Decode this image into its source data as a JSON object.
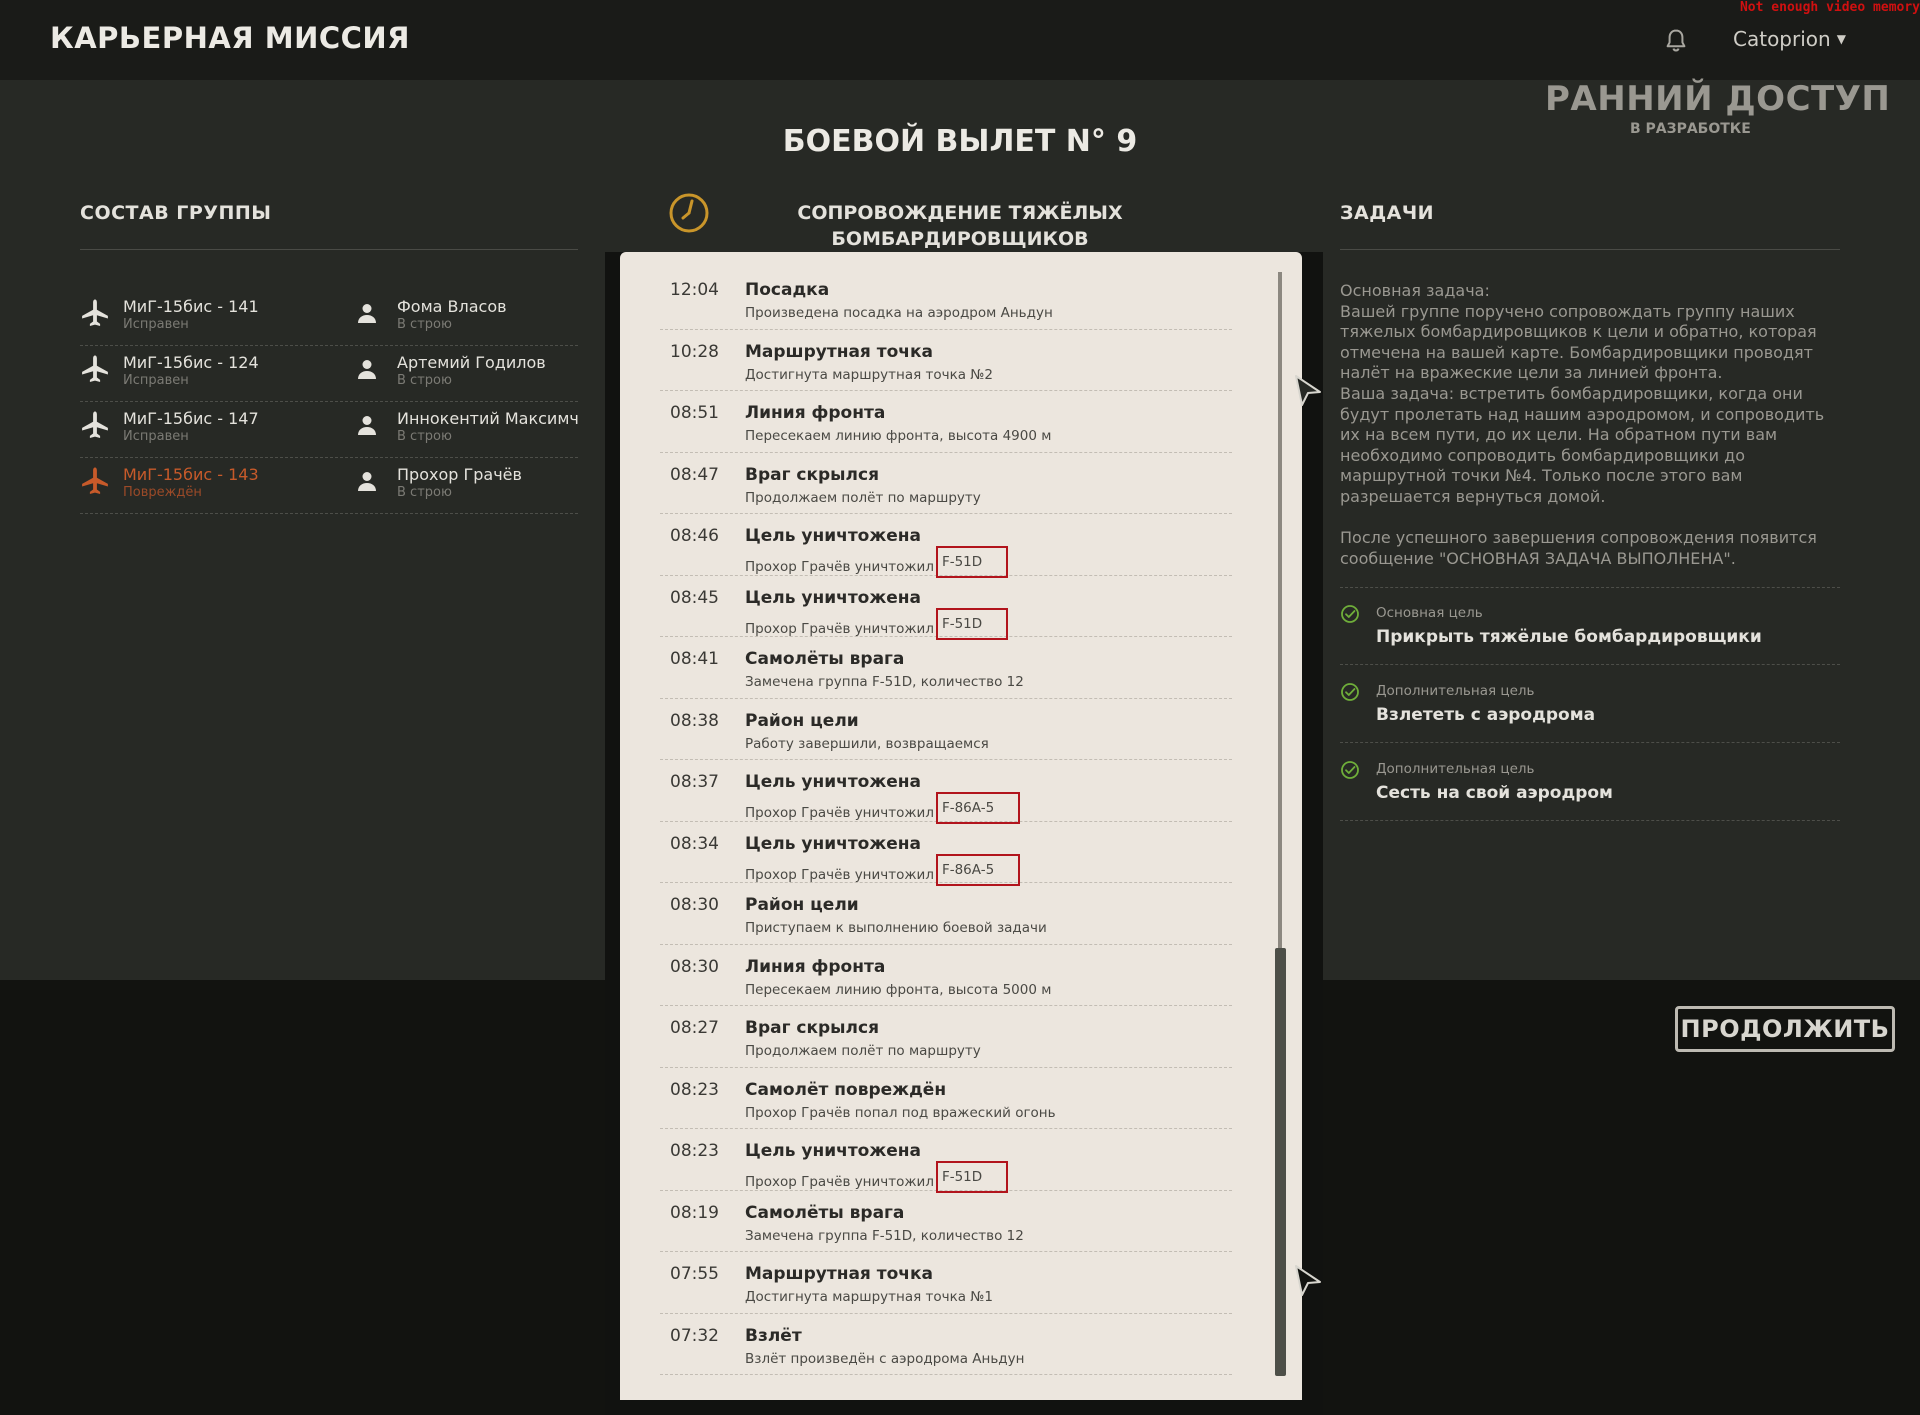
{
  "app_title": "КАРЬЕРНАЯ МИССИЯ",
  "user": {
    "name": "Catoprion"
  },
  "system_message": "Not enough video memory",
  "early_access": {
    "title": "РАННИЙ ДОСТУП",
    "subtitle": "В РАЗРАБОТКЕ"
  },
  "mission": {
    "title": "БОЕВОЙ ВЫЛЕТ N° 9",
    "name": "СОПРОВОЖДЕНИЕ ТЯЖЁЛЫХ БОМБАРДИРОВЩИКОВ"
  },
  "group": {
    "heading": "СОСТАВ ГРУППЫ",
    "rows": [
      {
        "aircraft": "МиГ-15бис -  141",
        "aircraft_status": "Исправен",
        "pilot": "Фома Власов",
        "pilot_status": "В строю",
        "damaged": false
      },
      {
        "aircraft": "МиГ-15бис -  124",
        "aircraft_status": "Исправен",
        "pilot": "Артемий Годилов",
        "pilot_status": "В строю",
        "damaged": false
      },
      {
        "aircraft": "МиГ-15бис -  147",
        "aircraft_status": "Исправен",
        "pilot": "Иннокентий Максимчук",
        "pilot_status": "В строю",
        "damaged": false
      },
      {
        "aircraft": "МиГ-15бис -  143",
        "aircraft_status": "Повреждён",
        "pilot": "Прохор Грачёв",
        "pilot_status": "В строю",
        "damaged": true
      }
    ]
  },
  "log": [
    {
      "time": "12:04",
      "title": "Посадка",
      "desc": "Произведена посадка на аэродром Аньдун",
      "aircraft": ""
    },
    {
      "time": "10:28",
      "title": "Маршрутная точка",
      "desc": "Достигнута маршрутная точка №2",
      "aircraft": ""
    },
    {
      "time": "08:51",
      "title": "Линия фронта",
      "desc": "Пересекаем линию фронта, высота 4900 м",
      "aircraft": ""
    },
    {
      "time": "08:47",
      "title": "Враг скрылся",
      "desc": "Продолжаем полёт по маршруту",
      "aircraft": ""
    },
    {
      "time": "08:46",
      "title": "Цель уничтожена",
      "desc": "Прохор Грачёв уничтожил",
      "aircraft": "F-51D"
    },
    {
      "time": "08:45",
      "title": "Цель уничтожена",
      "desc": "Прохор Грачёв уничтожил",
      "aircraft": "F-51D"
    },
    {
      "time": "08:41",
      "title": "Самолёты врага",
      "desc": "Замечена группа F-51D, количество 12",
      "aircraft": ""
    },
    {
      "time": "08:38",
      "title": "Район цели",
      "desc": "Работу завершили, возвращаемся",
      "aircraft": ""
    },
    {
      "time": "08:37",
      "title": "Цель уничтожена",
      "desc": "Прохор Грачёв уничтожил",
      "aircraft": "F-86A-5"
    },
    {
      "time": "08:34",
      "title": "Цель уничтожена",
      "desc": "Прохор Грачёв уничтожил",
      "aircraft": "F-86A-5"
    },
    {
      "time": "08:30",
      "title": "Район цели",
      "desc": "Приступаем к выполнению боевой задачи",
      "aircraft": ""
    },
    {
      "time": "08:30",
      "title": "Линия фронта",
      "desc": "Пересекаем линию фронта, высота 5000 м",
      "aircraft": ""
    },
    {
      "time": "08:27",
      "title": "Враг скрылся",
      "desc": "Продолжаем полёт по маршруту",
      "aircraft": ""
    },
    {
      "time": "08:23",
      "title": "Самолёт повреждён",
      "desc": "Прохор Грачёв попал под вражеский огонь",
      "aircraft": ""
    },
    {
      "time": "08:23",
      "title": "Цель уничтожена",
      "desc": "Прохор Грачёв уничтожил",
      "aircraft": "F-51D"
    },
    {
      "time": "08:19",
      "title": "Самолёты врага",
      "desc": "Замечена группа F-51D, количество 12",
      "aircraft": ""
    },
    {
      "time": "07:55",
      "title": "Маршрутная точка",
      "desc": "Достигнута маршрутная точка №1",
      "aircraft": ""
    },
    {
      "time": "07:32",
      "title": "Взлёт",
      "desc": "Взлёт произведён с аэродрома Аньдун",
      "aircraft": ""
    }
  ],
  "tasks": {
    "heading": "ЗАДАЧИ",
    "description_lines": [
      "Основная задача:",
      "Вашей группе поручено сопровождать группу наших",
      "тяжелых бомбардировщиков к цели и обратно, которая",
      "отмечена на вашей карте.  Бомбардировщики проводят",
      "налёт на вражеские цели за линией фронта.",
      "Ваша задача: встретить бомбардировщики, когда они",
      "будут пролетать над нашим аэродромом, и сопроводить",
      "их на всем пути, до их цели. На обратном пути вам",
      "необходимо сопроводить бомбардировщики до",
      "маршрутной точки №4. Только после этого вам",
      "разрешается вернуться домой.",
      "",
      "После успешного завершения сопровождения появится",
      "сообщение \"ОСНОВНАЯ ЗАДАЧА ВЫПОЛНЕНА\"."
    ],
    "items": [
      {
        "kind": "Основная цель",
        "goal": "Прикрыть тяжёлые бомбардировщики"
      },
      {
        "kind": "Дополнительная цель",
        "goal": "Взлететь с аэродрома"
      },
      {
        "kind": "Дополнительная цель",
        "goal": "Сесть на свой аэродром"
      }
    ]
  },
  "continue_label": "ПРОДОЛЖИТЬ",
  "colors": {
    "accent_orange": "#c75a2a",
    "highlight_red": "#b2141c",
    "check_green": "#6fae3a",
    "clock_gold": "#c9952a"
  }
}
